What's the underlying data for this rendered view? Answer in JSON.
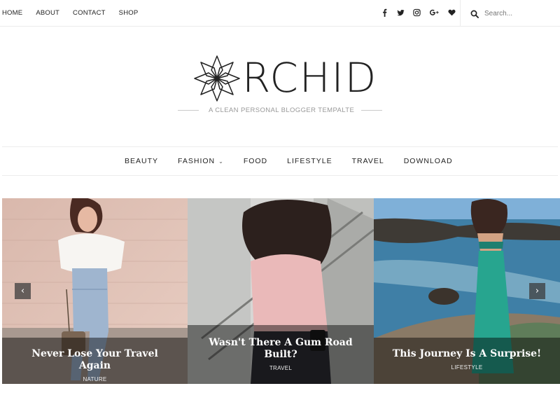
{
  "top_nav": {
    "items": [
      "HOME",
      "ABOUT",
      "CONTACT",
      "SHOP"
    ]
  },
  "social": {
    "icons": [
      "facebook-icon",
      "twitter-icon",
      "instagram-icon",
      "google-plus-icon",
      "heart-icon"
    ]
  },
  "search": {
    "placeholder": "Search..."
  },
  "brand": {
    "name": "RCHID",
    "tagline": "A CLEAN PERSONAL BLOGGER TEMPALTE"
  },
  "main_nav": {
    "items": [
      {
        "label": "BEAUTY"
      },
      {
        "label": "FASHION",
        "has_dropdown": true
      },
      {
        "label": "FOOD"
      },
      {
        "label": "LIFESTYLE"
      },
      {
        "label": "TRAVEL"
      },
      {
        "label": "DOWNLOAD"
      }
    ]
  },
  "slider": {
    "slides": [
      {
        "title": "Never Lose Your Travel Again",
        "category": "NATURE"
      },
      {
        "title": "Wasn't There A Gum Road Built?",
        "category": "TRAVEL"
      },
      {
        "title": "This Journey Is A Surprise!",
        "category": "LIFESTYLE"
      }
    ],
    "prev_label": "‹",
    "next_label": "›"
  },
  "colors": {
    "text": "#222222",
    "border": "#ececec",
    "tagline": "#999999",
    "caption_overlay": "rgba(0,0,0,0.45)"
  }
}
